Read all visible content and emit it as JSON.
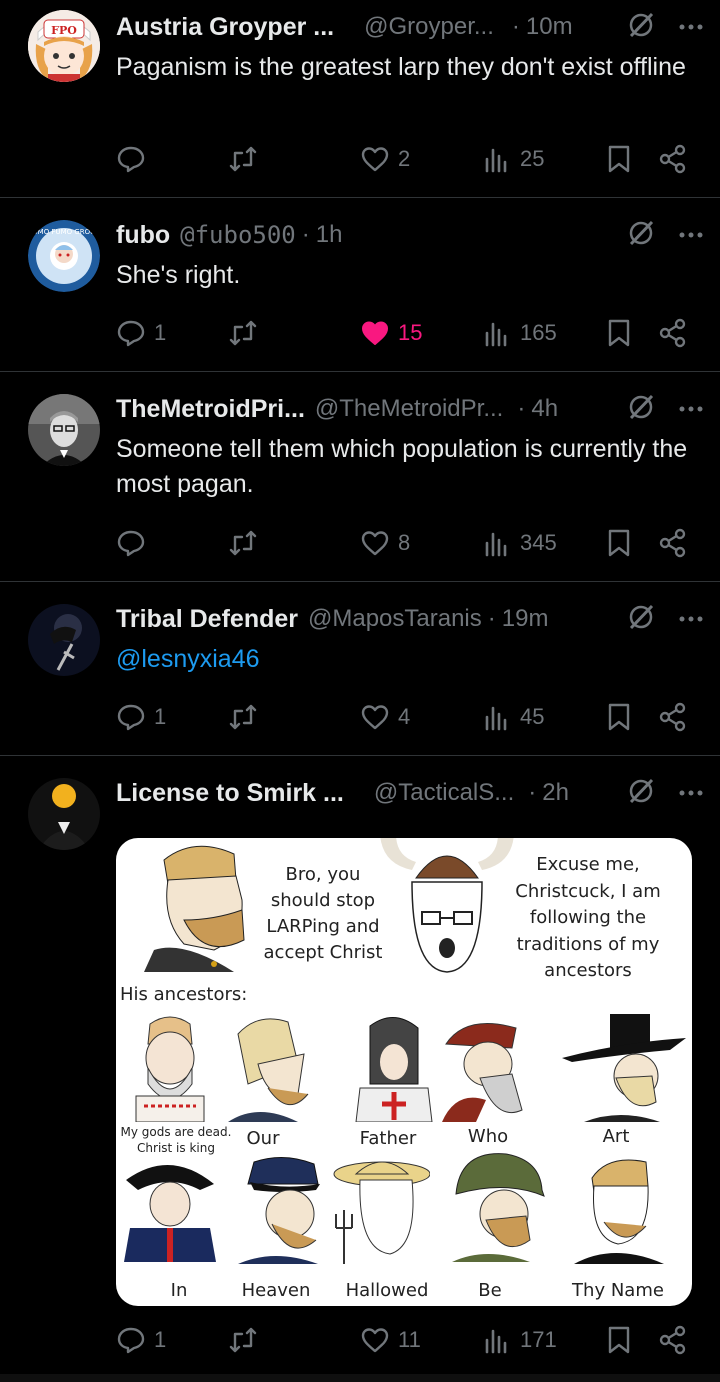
{
  "posts": [
    {
      "name": "Austria Groyper ...",
      "handle": "@Groyper...",
      "time": "10m",
      "text": "Paganism is the greatest larp they don't  exist offline",
      "replies": "",
      "reposts": "",
      "likes": "2",
      "views": "25",
      "liked": false
    },
    {
      "name": "fubo",
      "handle": "@fubo500",
      "time": "1h",
      "text": "She's right.",
      "replies": "1",
      "reposts": "",
      "likes": "15",
      "views": "165",
      "liked": true,
      "avatar_text": "FUMO FUMO GROUP"
    },
    {
      "name": "TheMetroidPri...",
      "handle": "@TheMetroidPr...",
      "time": "4h",
      "text": "Someone tell them which population is currently the most pagan.",
      "replies": "",
      "reposts": "",
      "likes": "8",
      "views": "345",
      "liked": false
    },
    {
      "name": "Tribal Defender",
      "handle": "@MaposTaranis",
      "time": "19m",
      "text": "@lesnyxia46",
      "replies": "1",
      "reposts": "",
      "likes": "4",
      "views": "45",
      "liked": false
    },
    {
      "name": "License to Smirk ...",
      "handle": "@TacticalS...",
      "time": "2h",
      "text": "",
      "replies": "1",
      "reposts": "",
      "likes": "11",
      "views": "171",
      "liked": false
    }
  ],
  "meme": {
    "bubble_left": "Bro, you should stop LARPing and accept Christ",
    "bubble_right": "Excuse me, Christcuck, I am following the traditions of my ancestors",
    "ancestors_label": "His ancestors:",
    "small_caption": "My gods are dead. Christ is king",
    "row1_captions": [
      "Our",
      "Father",
      "Who",
      "Art"
    ],
    "row2_captions": [
      "In",
      "Heaven",
      "Hallowed",
      "Be",
      "Thy Name"
    ]
  },
  "avatar_text_fpo": "FPO",
  "colors": {
    "background": "#000000",
    "text": "#e7e9ea",
    "muted": "#71767b",
    "like": "#f91880",
    "link": "#1d9bf0",
    "divider": "#2f3336"
  },
  "icons": [
    "reply-icon",
    "repost-icon",
    "like-icon",
    "views-icon",
    "bookmark-icon",
    "share-icon",
    "grok-icon",
    "more-icon"
  ]
}
